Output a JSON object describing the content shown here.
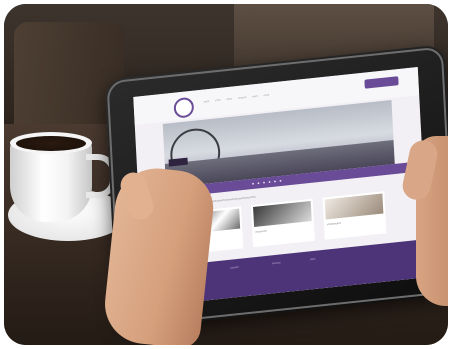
{
  "photo": {
    "subject": "",
    "site_headline": "",
    "nav_items": [],
    "cards": [],
    "footer_columns": []
  },
  "colors": {
    "accent": "#6a4b98",
    "footer": "#4d3479",
    "table": "#3a2d24"
  },
  "icons": [
    "coffee-cup-icon"
  ]
}
